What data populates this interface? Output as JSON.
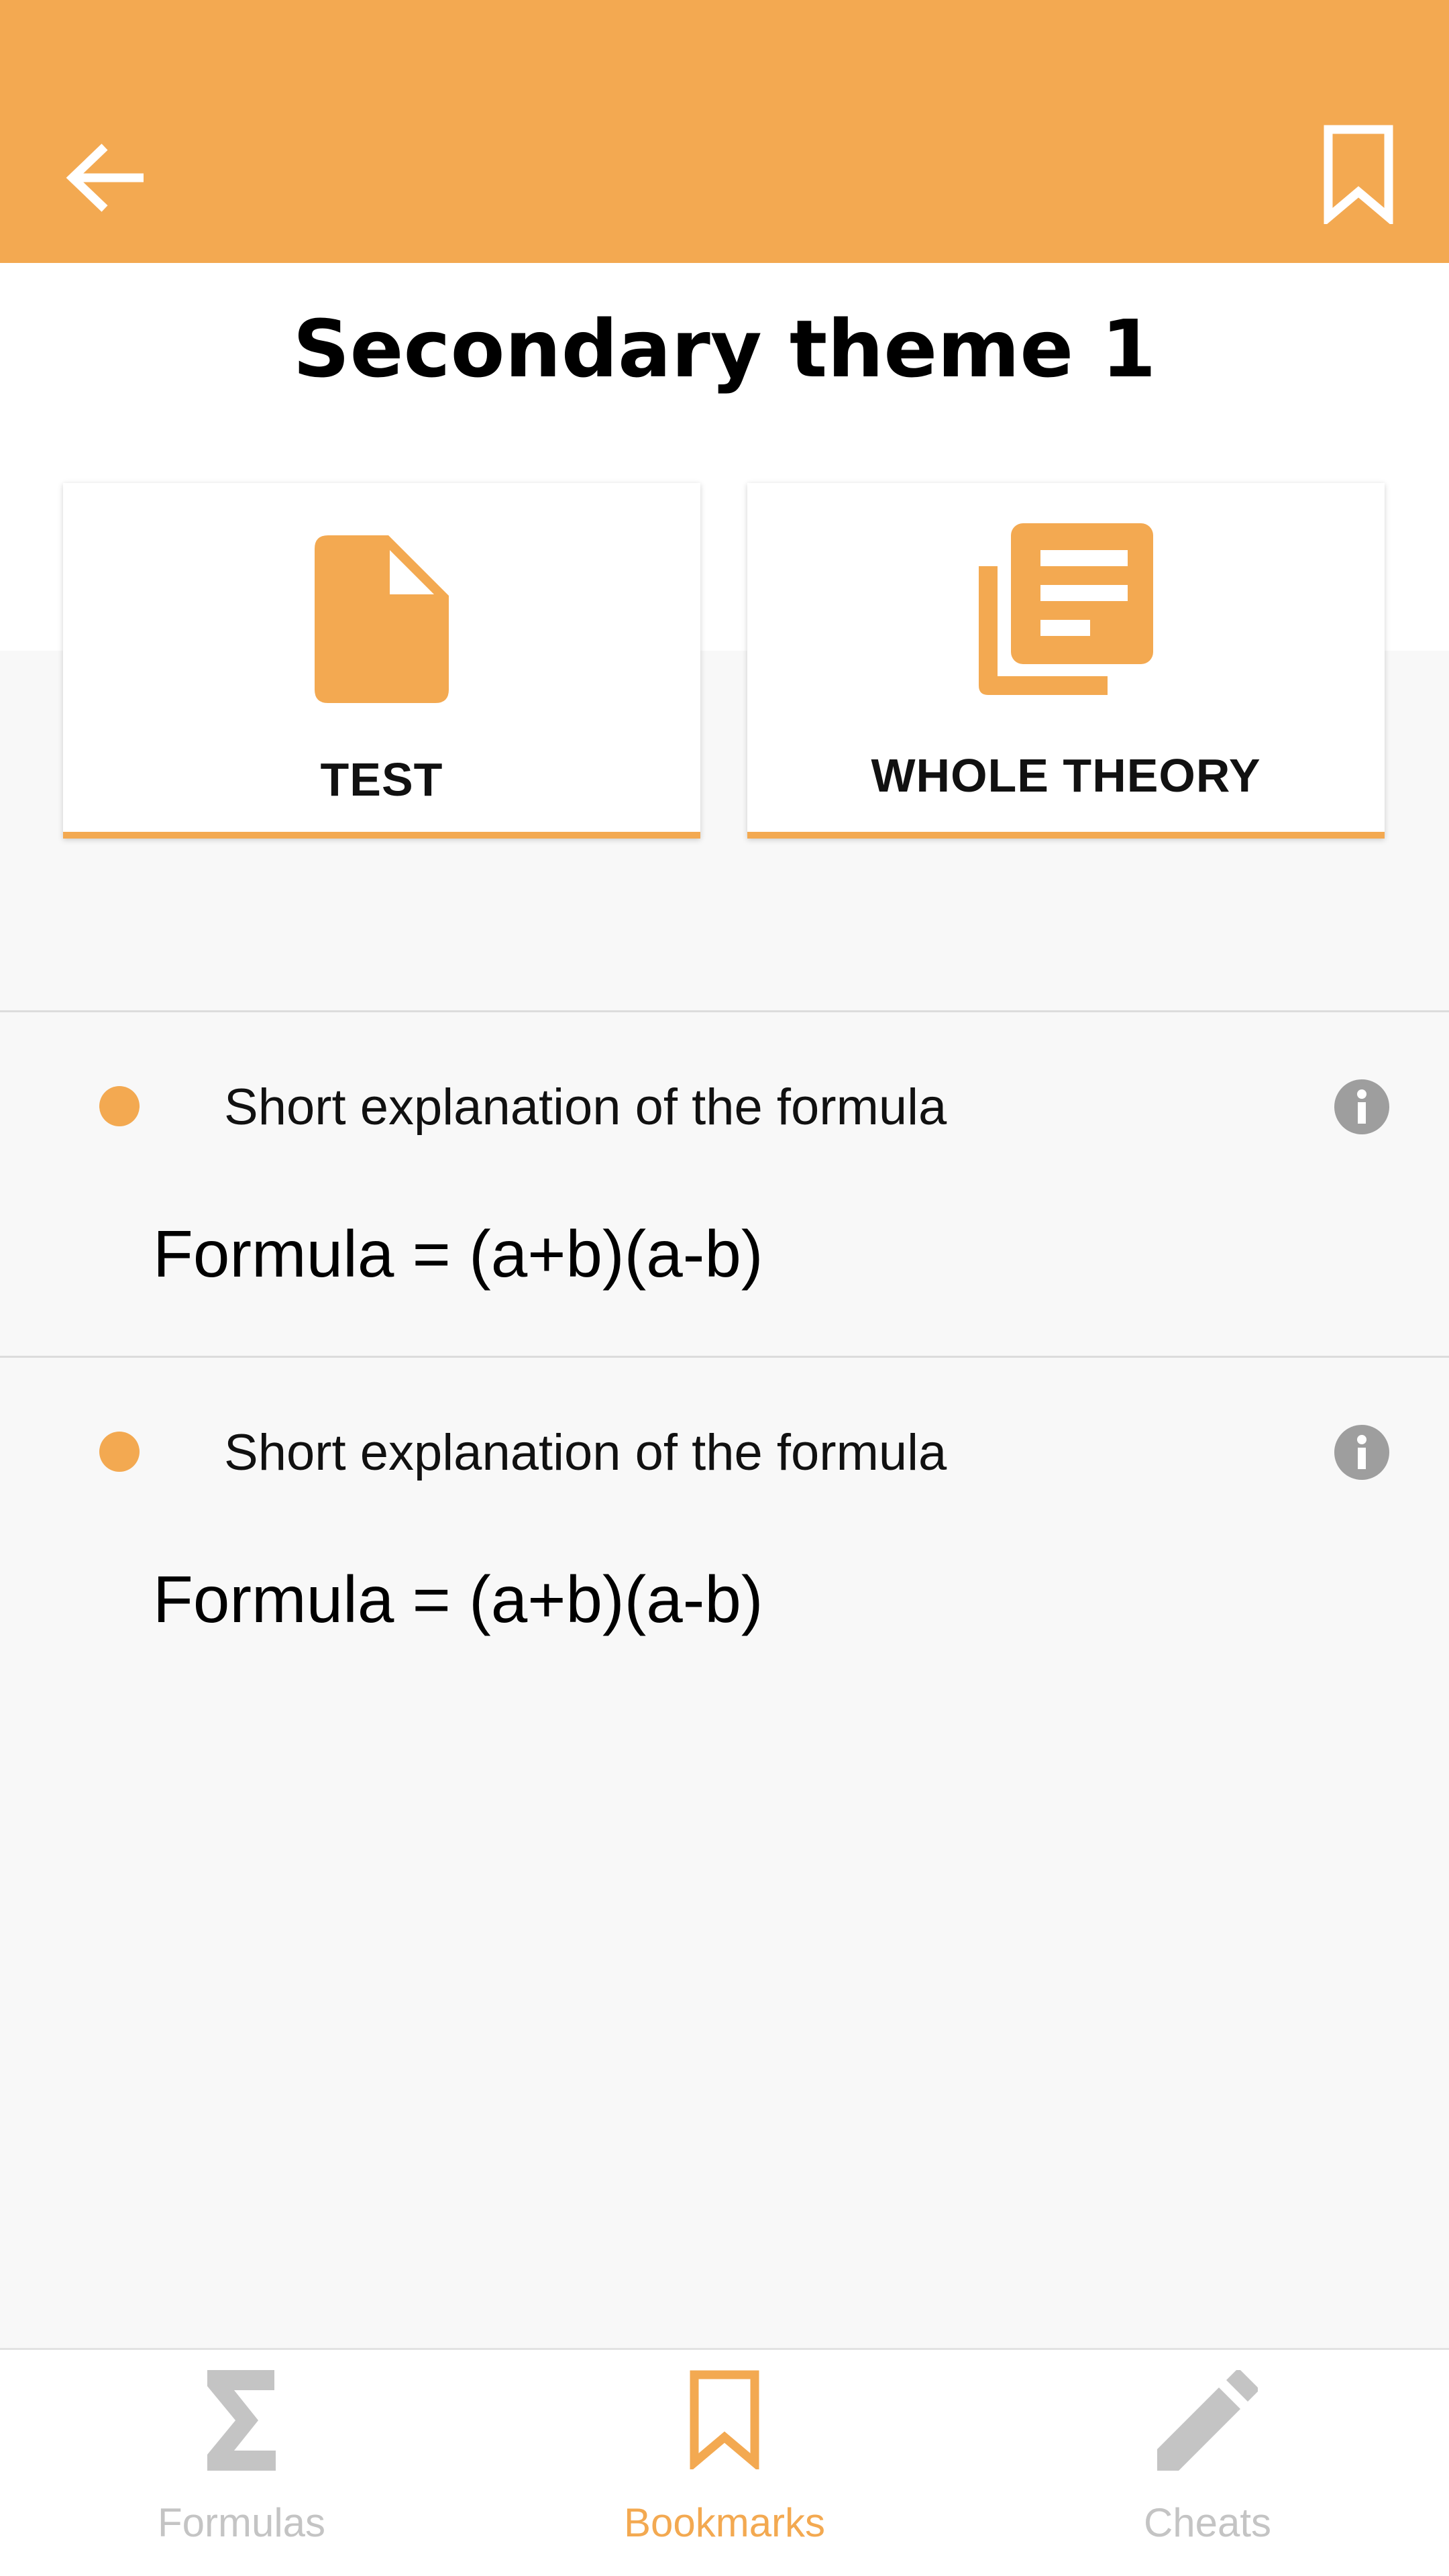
{
  "header": {
    "back_icon": "arrow-left-icon",
    "bookmark_icon": "bookmark-outline-icon",
    "background_color": "#f3a951"
  },
  "page": {
    "title": "Secondary theme 1"
  },
  "actions": [
    {
      "label": "TEST",
      "icon": "file-icon"
    },
    {
      "label": "WHOLE THEORY",
      "icon": "library-books-icon"
    }
  ],
  "formulas": [
    {
      "explanation": "Short explanation of the formula",
      "formula": "Formula = (a+b)(a-b)",
      "icon": "info-icon"
    },
    {
      "explanation": "Short explanation of the formula",
      "formula": "Formula = (a+b)(a-b)",
      "icon": "info-icon"
    }
  ],
  "bottom_nav": {
    "items": [
      {
        "label": "Formulas",
        "icon": "sigma-icon",
        "active": false
      },
      {
        "label": "Bookmarks",
        "icon": "bookmark-outline-icon",
        "active": true
      },
      {
        "label": "Cheats",
        "icon": "pencil-icon",
        "active": false
      }
    ],
    "active_color": "#f3a951",
    "inactive_color": "#c4c4c4"
  }
}
